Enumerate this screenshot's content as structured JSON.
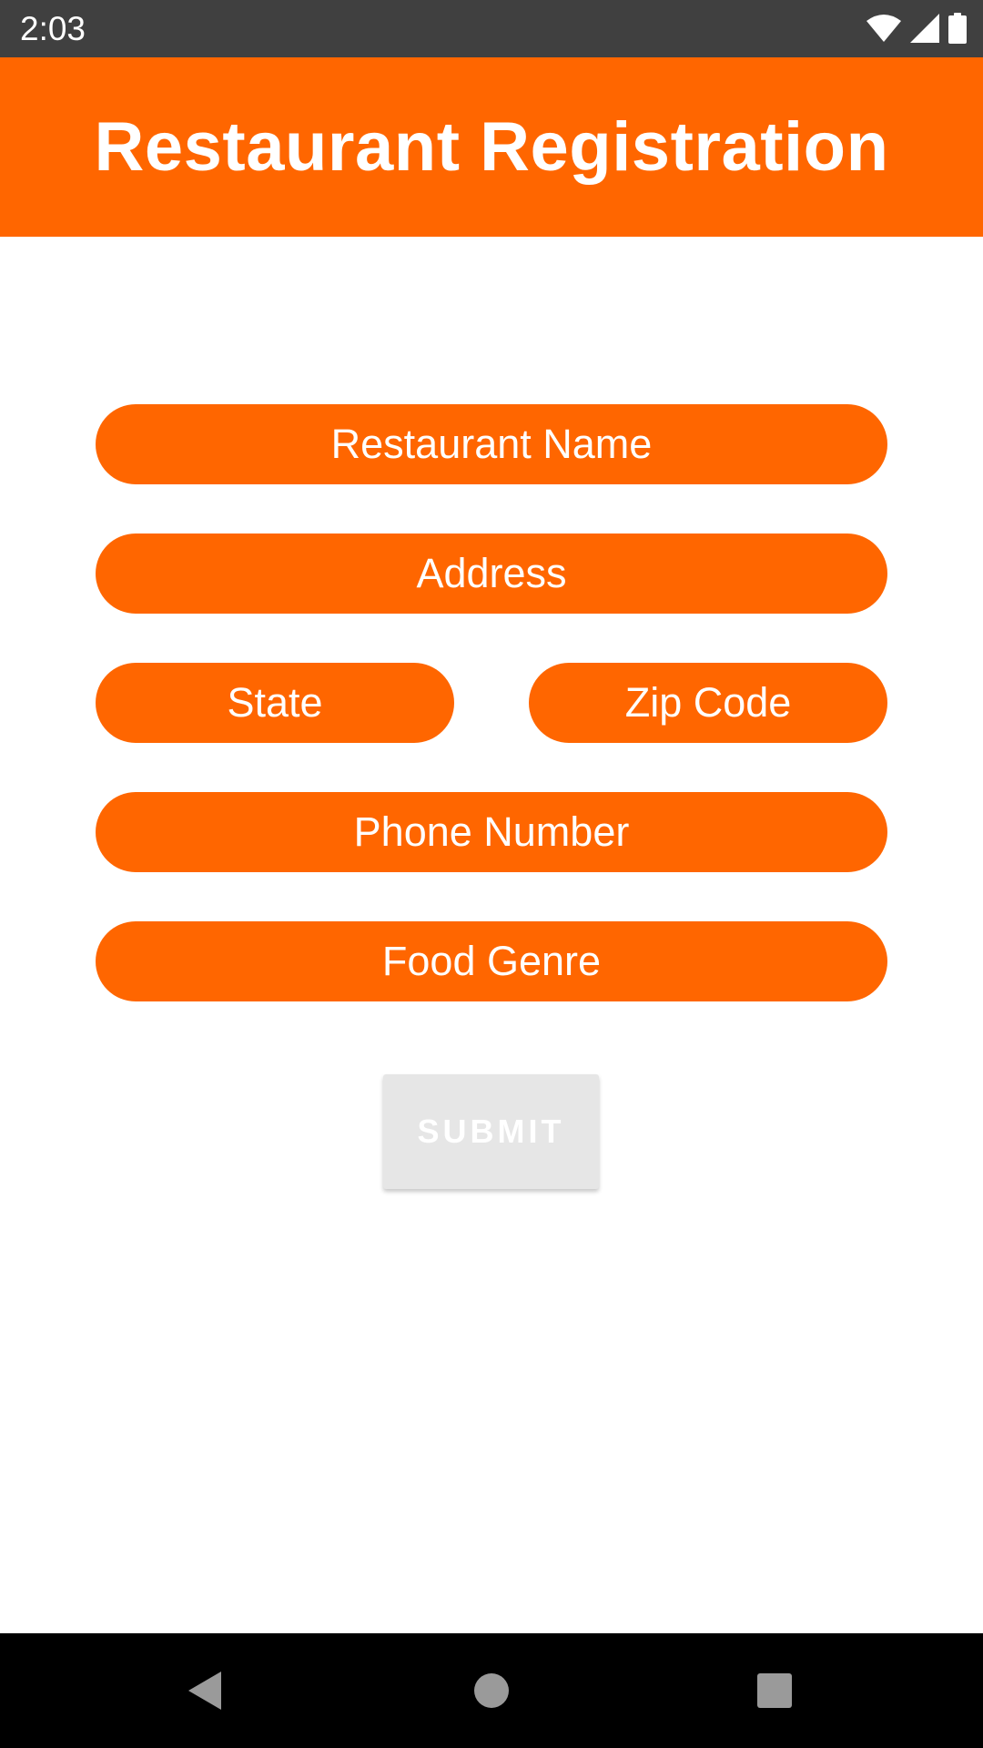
{
  "status_bar": {
    "time": "2:03",
    "icons": [
      "wifi-icon",
      "signal-icon",
      "battery-icon"
    ]
  },
  "app_bar": {
    "title": "Restaurant Registration",
    "color": "#ff6600"
  },
  "form": {
    "restaurant_name": {
      "placeholder": "Restaurant Name",
      "value": ""
    },
    "address": {
      "placeholder": "Address",
      "value": ""
    },
    "state": {
      "placeholder": "State",
      "value": ""
    },
    "zip_code": {
      "placeholder": "Zip Code",
      "value": ""
    },
    "phone_number": {
      "placeholder": "Phone Number",
      "value": ""
    },
    "food_genre": {
      "placeholder": "Food Genre",
      "value": ""
    },
    "submit_label": "SUBMIT"
  },
  "nav_bar": {
    "icons": [
      "back-icon",
      "home-icon",
      "recents-icon"
    ]
  }
}
